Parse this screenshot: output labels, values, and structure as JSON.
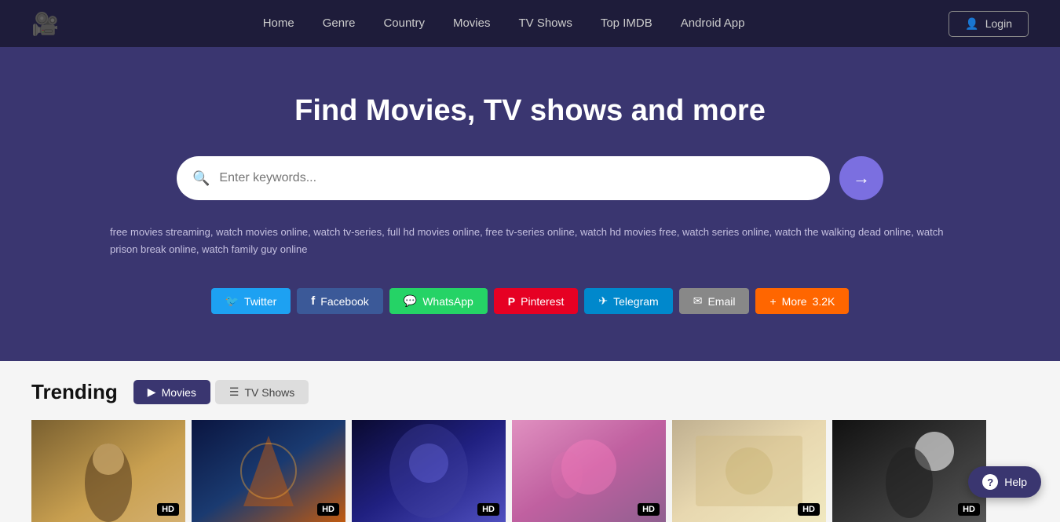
{
  "navbar": {
    "logo_icon": "camera-icon",
    "links": [
      {
        "label": "Home",
        "href": "#"
      },
      {
        "label": "Genre",
        "href": "#"
      },
      {
        "label": "Country",
        "href": "#"
      },
      {
        "label": "Movies",
        "href": "#"
      },
      {
        "label": "TV Shows",
        "href": "#"
      },
      {
        "label": "Top IMDB",
        "href": "#"
      },
      {
        "label": "Android App",
        "href": "#"
      }
    ],
    "login_label": "Login"
  },
  "hero": {
    "heading": "Find Movies, TV shows and more",
    "search_placeholder": "Enter keywords...",
    "search_button_label": "→"
  },
  "tags": {
    "text": "free movies streaming, watch movies online, watch tv-series, full hd movies online, free tv-series online, watch hd movies free, watch series online, watch the walking dead online, watch prison break online, watch family guy online"
  },
  "social": {
    "buttons": [
      {
        "label": "Twitter",
        "class": "twitter",
        "icon": "twitter-icon"
      },
      {
        "label": "Facebook",
        "class": "facebook",
        "icon": "fb-icon"
      },
      {
        "label": "WhatsApp",
        "class": "whatsapp",
        "icon": "wp-icon"
      },
      {
        "label": "Pinterest",
        "class": "pinterest",
        "icon": "pin-icon"
      },
      {
        "label": "Telegram",
        "class": "telegram",
        "icon": "tg-icon"
      },
      {
        "label": "Email",
        "class": "email",
        "icon": "mail-icon"
      },
      {
        "label": "More",
        "class": "more",
        "icon": "plus-icon",
        "count": "3.2K"
      }
    ]
  },
  "trending": {
    "title": "Trending",
    "tabs": [
      {
        "label": "Movies",
        "active": true,
        "icon": "play-icon"
      },
      {
        "label": "TV Shows",
        "active": false,
        "icon": "list-icon"
      }
    ],
    "movies": [
      {
        "id": 1,
        "badge": "HD",
        "card_class": "card-1"
      },
      {
        "id": 2,
        "badge": "HD",
        "card_class": "card-2"
      },
      {
        "id": 3,
        "badge": "HD",
        "card_class": "card-3"
      },
      {
        "id": 4,
        "badge": "HD",
        "card_class": "card-4"
      },
      {
        "id": 5,
        "badge": "HD",
        "card_class": "card-5"
      },
      {
        "id": 6,
        "badge": "HD",
        "card_class": "card-6"
      }
    ]
  },
  "help_button": {
    "label": "Help",
    "icon": "question-icon"
  }
}
